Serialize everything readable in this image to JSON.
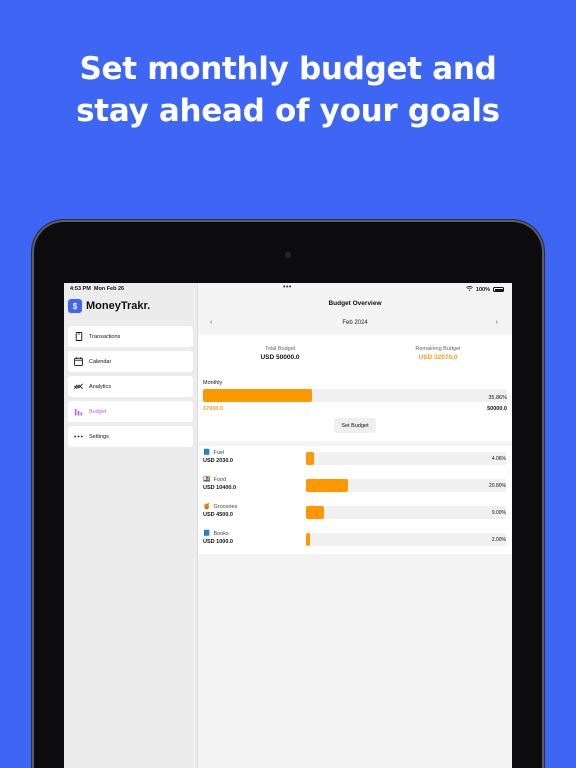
{
  "headline": {
    "line1": "Set monthly budget and",
    "line2": "stay ahead of your goals"
  },
  "status_bar": {
    "time": "4:53 PM",
    "date": "Mon Feb 26",
    "battery": "100%"
  },
  "sidebar": {
    "app_name": "MoneyTrakr.",
    "items": [
      {
        "label": "Transactions",
        "icon": "phone-icon",
        "active": false
      },
      {
        "label": "Calendar",
        "icon": "calendar-icon",
        "active": false
      },
      {
        "label": "Analytics",
        "icon": "chart-line-icon",
        "active": false
      },
      {
        "label": "Budget",
        "icon": "bar-chart-icon",
        "active": true
      },
      {
        "label": "Settings",
        "icon": "more-dots-icon",
        "active": false
      }
    ]
  },
  "main": {
    "title": "Budget Overview",
    "month": "Feb 2024",
    "total_budget_label": "Total Budget",
    "total_budget_value": "USD 50000.0",
    "remaining_budget_label": "Remaining Budget",
    "remaining_budget_value": "USD 32070.0",
    "monthly_label": "Monthly",
    "monthly_percent_label": "35.86%",
    "monthly_fraction": 0.3586,
    "monthly_spent": "17930.0",
    "monthly_total": "50000.0",
    "set_budget_label": "Set Budget",
    "categories": [
      {
        "emoji": "📘",
        "name": "Fuel",
        "amount": "USD 2030.0",
        "percent_label": "4.06%",
        "fraction": 0.0406
      },
      {
        "emoji": "🍱",
        "name": "Food",
        "amount": "USD 10400.0",
        "percent_label": "20.80%",
        "fraction": 0.208
      },
      {
        "emoji": "🍯",
        "name": "Groceries",
        "amount": "USD 4500.0",
        "percent_label": "9.00%",
        "fraction": 0.09
      },
      {
        "emoji": "📘",
        "name": "Books",
        "amount": "USD 1000.0",
        "percent_label": "2.00%",
        "fraction": 0.02
      }
    ]
  },
  "colors": {
    "background": "#3d66f5",
    "accent_orange": "#ff9800",
    "active_nav": "#b05cf0"
  }
}
